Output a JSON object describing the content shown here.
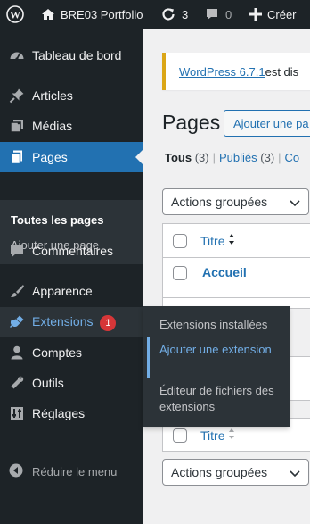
{
  "admin_bar": {
    "site_name": "BRE03 Portfolio",
    "updates_count": "3",
    "comments_count": "0",
    "new_label": "Créer"
  },
  "sidebar": {
    "items": [
      {
        "label": "Tableau de bord",
        "icon": "dashboard-icon"
      },
      {
        "label": "Articles",
        "icon": "pushpin-icon"
      },
      {
        "label": "Médias",
        "icon": "media-icon"
      },
      {
        "label": "Pages",
        "icon": "pages-icon"
      },
      {
        "label": "Commentaires",
        "icon": "comment-icon"
      },
      {
        "label": "Apparence",
        "icon": "paintbrush-icon"
      },
      {
        "label": "Extensions",
        "icon": "plugin-icon",
        "badge": "1"
      },
      {
        "label": "Comptes",
        "icon": "user-icon"
      },
      {
        "label": "Outils",
        "icon": "wrench-icon"
      },
      {
        "label": "Réglages",
        "icon": "settings-icon"
      }
    ],
    "pages_submenu": [
      "Toutes les pages",
      "Ajouter une page"
    ],
    "collapse_label": "Réduire le menu"
  },
  "extensions_flyout": {
    "items": [
      "Extensions installées",
      "Ajouter une extension",
      "Éditeur de fichiers des extensions"
    ]
  },
  "main": {
    "notice_link": "WordPress 6.7.1",
    "notice_text": " est dis",
    "page_title": "Pages",
    "add_button": "Ajouter une pa",
    "views": {
      "all_label": "Tous",
      "all_count": "(3)",
      "published_label": "Publiés",
      "published_count": "(3)",
      "next_label": "Co",
      "separator": "|"
    },
    "bulk_actions_label": "Actions groupées",
    "column_title": "Titre",
    "rows": [
      "Accueil"
    ]
  },
  "colors": {
    "accent": "#2271b1",
    "sidebar_bg": "#1d2327",
    "submenu_bg": "#2c3338",
    "badge": "#d63638",
    "notice_border": "#dba617"
  }
}
